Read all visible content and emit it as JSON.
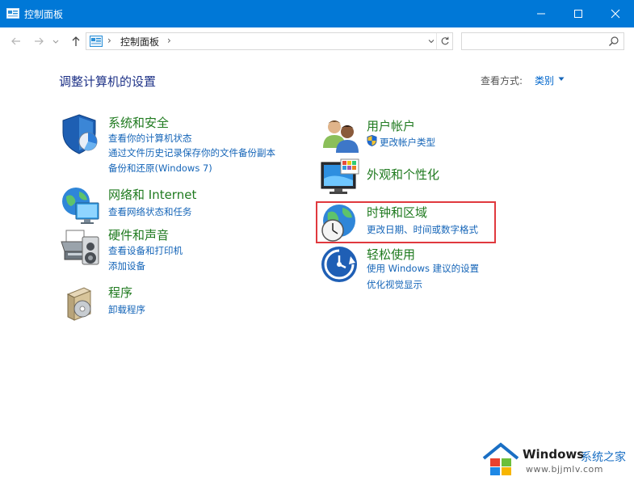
{
  "window": {
    "title": "控制面板"
  },
  "nav": {
    "breadcrumb": "控制面板",
    "search_placeholder": ""
  },
  "header": {
    "heading": "调整计算机的设置",
    "view_by_label": "查看方式:",
    "view_by_value": "类别"
  },
  "categories": {
    "system": {
      "title": "系统和安全",
      "links": [
        "查看你的计算机状态",
        "通过文件历史记录保存你的文件备份副本",
        "备份和还原(Windows 7)"
      ]
    },
    "network": {
      "title": "网络和 Internet",
      "links": [
        "查看网络状态和任务"
      ]
    },
    "hardware": {
      "title": "硬件和声音",
      "links": [
        "查看设备和打印机",
        "添加设备"
      ]
    },
    "programs": {
      "title": "程序",
      "links": [
        "卸载程序"
      ]
    },
    "users": {
      "title": "用户帐户",
      "links": [
        "更改帐户类型"
      ]
    },
    "appearance": {
      "title": "外观和个性化",
      "links": []
    },
    "clock": {
      "title": "时钟和区域",
      "links": [
        "更改日期、时间或数字格式"
      ]
    },
    "ease": {
      "title": "轻松使用",
      "links": [
        "使用 Windows 建议的设置",
        "优化视觉显示"
      ]
    }
  },
  "watermark": {
    "name": "Windows",
    "cn": "系统之家",
    "url": "www.bjjmlv.com"
  },
  "colors": {
    "titlebar": "#0078d7",
    "link": "#1565b8",
    "category_title": "#1f7a1f",
    "highlight": "#e0393e"
  }
}
